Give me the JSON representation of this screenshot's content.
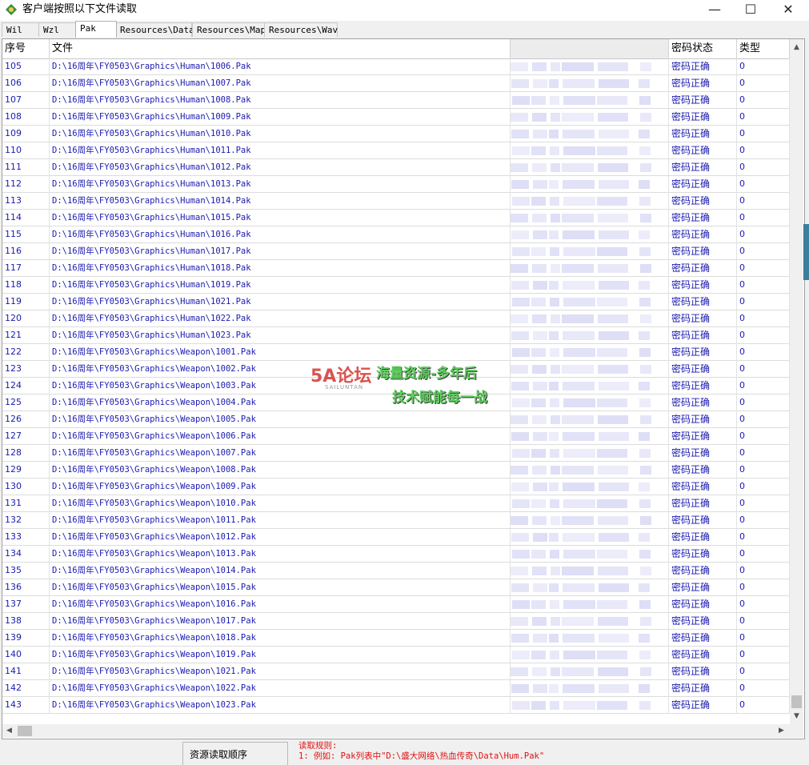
{
  "window": {
    "title": "客户端按照以下文件读取",
    "min_glyph": "—",
    "max_glyph": "☐",
    "close_glyph": "✕"
  },
  "tabs": [
    {
      "label": "Wil",
      "active": false
    },
    {
      "label": "Wzl",
      "active": false
    },
    {
      "label": "Pak",
      "active": true
    },
    {
      "label": "Resources\\Data",
      "active": false
    },
    {
      "label": "Resources\\Map",
      "active": false
    },
    {
      "label": "Resources\\Wav",
      "active": false
    }
  ],
  "table": {
    "columns": {
      "seq": "序号",
      "file": "文件",
      "password": "",
      "state": "密码状态",
      "type": "类型"
    },
    "rows": [
      {
        "seq": "105",
        "file": "D:\\16周年\\FY0503\\Graphics\\Human\\1006.Pak",
        "state": "密码正确",
        "type": "0"
      },
      {
        "seq": "106",
        "file": "D:\\16周年\\FY0503\\Graphics\\Human\\1007.Pak",
        "state": "密码正确",
        "type": "0"
      },
      {
        "seq": "107",
        "file": "D:\\16周年\\FY0503\\Graphics\\Human\\1008.Pak",
        "state": "密码正确",
        "type": "0"
      },
      {
        "seq": "108",
        "file": "D:\\16周年\\FY0503\\Graphics\\Human\\1009.Pak",
        "state": "密码正确",
        "type": "0"
      },
      {
        "seq": "109",
        "file": "D:\\16周年\\FY0503\\Graphics\\Human\\1010.Pak",
        "state": "密码正确",
        "type": "0"
      },
      {
        "seq": "110",
        "file": "D:\\16周年\\FY0503\\Graphics\\Human\\1011.Pak",
        "state": "密码正确",
        "type": "0"
      },
      {
        "seq": "111",
        "file": "D:\\16周年\\FY0503\\Graphics\\Human\\1012.Pak",
        "state": "密码正确",
        "type": "0"
      },
      {
        "seq": "112",
        "file": "D:\\16周年\\FY0503\\Graphics\\Human\\1013.Pak",
        "state": "密码正确",
        "type": "0"
      },
      {
        "seq": "113",
        "file": "D:\\16周年\\FY0503\\Graphics\\Human\\1014.Pak",
        "state": "密码正确",
        "type": "0"
      },
      {
        "seq": "114",
        "file": "D:\\16周年\\FY0503\\Graphics\\Human\\1015.Pak",
        "state": "密码正确",
        "type": "0"
      },
      {
        "seq": "115",
        "file": "D:\\16周年\\FY0503\\Graphics\\Human\\1016.Pak",
        "state": "密码正确",
        "type": "0"
      },
      {
        "seq": "116",
        "file": "D:\\16周年\\FY0503\\Graphics\\Human\\1017.Pak",
        "state": "密码正确",
        "type": "0"
      },
      {
        "seq": "117",
        "file": "D:\\16周年\\FY0503\\Graphics\\Human\\1018.Pak",
        "state": "密码正确",
        "type": "0"
      },
      {
        "seq": "118",
        "file": "D:\\16周年\\FY0503\\Graphics\\Human\\1019.Pak",
        "state": "密码正确",
        "type": "0"
      },
      {
        "seq": "119",
        "file": "D:\\16周年\\FY0503\\Graphics\\Human\\1021.Pak",
        "state": "密码正确",
        "type": "0"
      },
      {
        "seq": "120",
        "file": "D:\\16周年\\FY0503\\Graphics\\Human\\1022.Pak",
        "state": "密码正确",
        "type": "0"
      },
      {
        "seq": "121",
        "file": "D:\\16周年\\FY0503\\Graphics\\Human\\1023.Pak",
        "state": "密码正确",
        "type": "0"
      },
      {
        "seq": "122",
        "file": "D:\\16周年\\FY0503\\Graphics\\Weapon\\1001.Pak",
        "state": "密码正确",
        "type": "0"
      },
      {
        "seq": "123",
        "file": "D:\\16周年\\FY0503\\Graphics\\Weapon\\1002.Pak",
        "state": "密码正确",
        "type": "0"
      },
      {
        "seq": "124",
        "file": "D:\\16周年\\FY0503\\Graphics\\Weapon\\1003.Pak",
        "state": "密码正确",
        "type": "0"
      },
      {
        "seq": "125",
        "file": "D:\\16周年\\FY0503\\Graphics\\Weapon\\1004.Pak",
        "state": "密码正确",
        "type": "0"
      },
      {
        "seq": "126",
        "file": "D:\\16周年\\FY0503\\Graphics\\Weapon\\1005.Pak",
        "state": "密码正确",
        "type": "0"
      },
      {
        "seq": "127",
        "file": "D:\\16周年\\FY0503\\Graphics\\Weapon\\1006.Pak",
        "state": "密码正确",
        "type": "0"
      },
      {
        "seq": "128",
        "file": "D:\\16周年\\FY0503\\Graphics\\Weapon\\1007.Pak",
        "state": "密码正确",
        "type": "0"
      },
      {
        "seq": "129",
        "file": "D:\\16周年\\FY0503\\Graphics\\Weapon\\1008.Pak",
        "state": "密码正确",
        "type": "0"
      },
      {
        "seq": "130",
        "file": "D:\\16周年\\FY0503\\Graphics\\Weapon\\1009.Pak",
        "state": "密码正确",
        "type": "0"
      },
      {
        "seq": "131",
        "file": "D:\\16周年\\FY0503\\Graphics\\Weapon\\1010.Pak",
        "state": "密码正确",
        "type": "0"
      },
      {
        "seq": "132",
        "file": "D:\\16周年\\FY0503\\Graphics\\Weapon\\1011.Pak",
        "state": "密码正确",
        "type": "0"
      },
      {
        "seq": "133",
        "file": "D:\\16周年\\FY0503\\Graphics\\Weapon\\1012.Pak",
        "state": "密码正确",
        "type": "0"
      },
      {
        "seq": "134",
        "file": "D:\\16周年\\FY0503\\Graphics\\Weapon\\1013.Pak",
        "state": "密码正确",
        "type": "0"
      },
      {
        "seq": "135",
        "file": "D:\\16周年\\FY0503\\Graphics\\Weapon\\1014.Pak",
        "state": "密码正确",
        "type": "0"
      },
      {
        "seq": "136",
        "file": "D:\\16周年\\FY0503\\Graphics\\Weapon\\1015.Pak",
        "state": "密码正确",
        "type": "0"
      },
      {
        "seq": "137",
        "file": "D:\\16周年\\FY0503\\Graphics\\Weapon\\1016.Pak",
        "state": "密码正确",
        "type": "0"
      },
      {
        "seq": "138",
        "file": "D:\\16周年\\FY0503\\Graphics\\Weapon\\1017.Pak",
        "state": "密码正确",
        "type": "0"
      },
      {
        "seq": "139",
        "file": "D:\\16周年\\FY0503\\Graphics\\Weapon\\1018.Pak",
        "state": "密码正确",
        "type": "0"
      },
      {
        "seq": "140",
        "file": "D:\\16周年\\FY0503\\Graphics\\Weapon\\1019.Pak",
        "state": "密码正确",
        "type": "0"
      },
      {
        "seq": "141",
        "file": "D:\\16周年\\FY0503\\Graphics\\Weapon\\1021.Pak",
        "state": "密码正确",
        "type": "0"
      },
      {
        "seq": "142",
        "file": "D:\\16周年\\FY0503\\Graphics\\Weapon\\1022.Pak",
        "state": "密码正确",
        "type": "0"
      },
      {
        "seq": "143",
        "file": "D:\\16周年\\FY0503\\Graphics\\Weapon\\1023.Pak",
        "state": "密码正确",
        "type": "0"
      }
    ]
  },
  "watermark": {
    "logo": "5A论坛",
    "logo_sub": "SAILUNTAN",
    "line1": "海量资源-多年后",
    "line2": "技术赋能每一战"
  },
  "bottom": {
    "order_label": "资源读取顺序",
    "rules_title": "读取规则:",
    "rule_1": "1: 例如: Pak列表中\"D:\\盛大网络\\热血传奇\\Data\\Hum.Pak\""
  },
  "colors": {
    "row_text": "#1a1ab0",
    "rules_text": "#e01010",
    "blur": "#dcdcf6"
  },
  "icons": {
    "app": "app-icon",
    "scroll_up": "▲",
    "scroll_down": "▼",
    "scroll_left": "◀",
    "scroll_right": "▶"
  }
}
